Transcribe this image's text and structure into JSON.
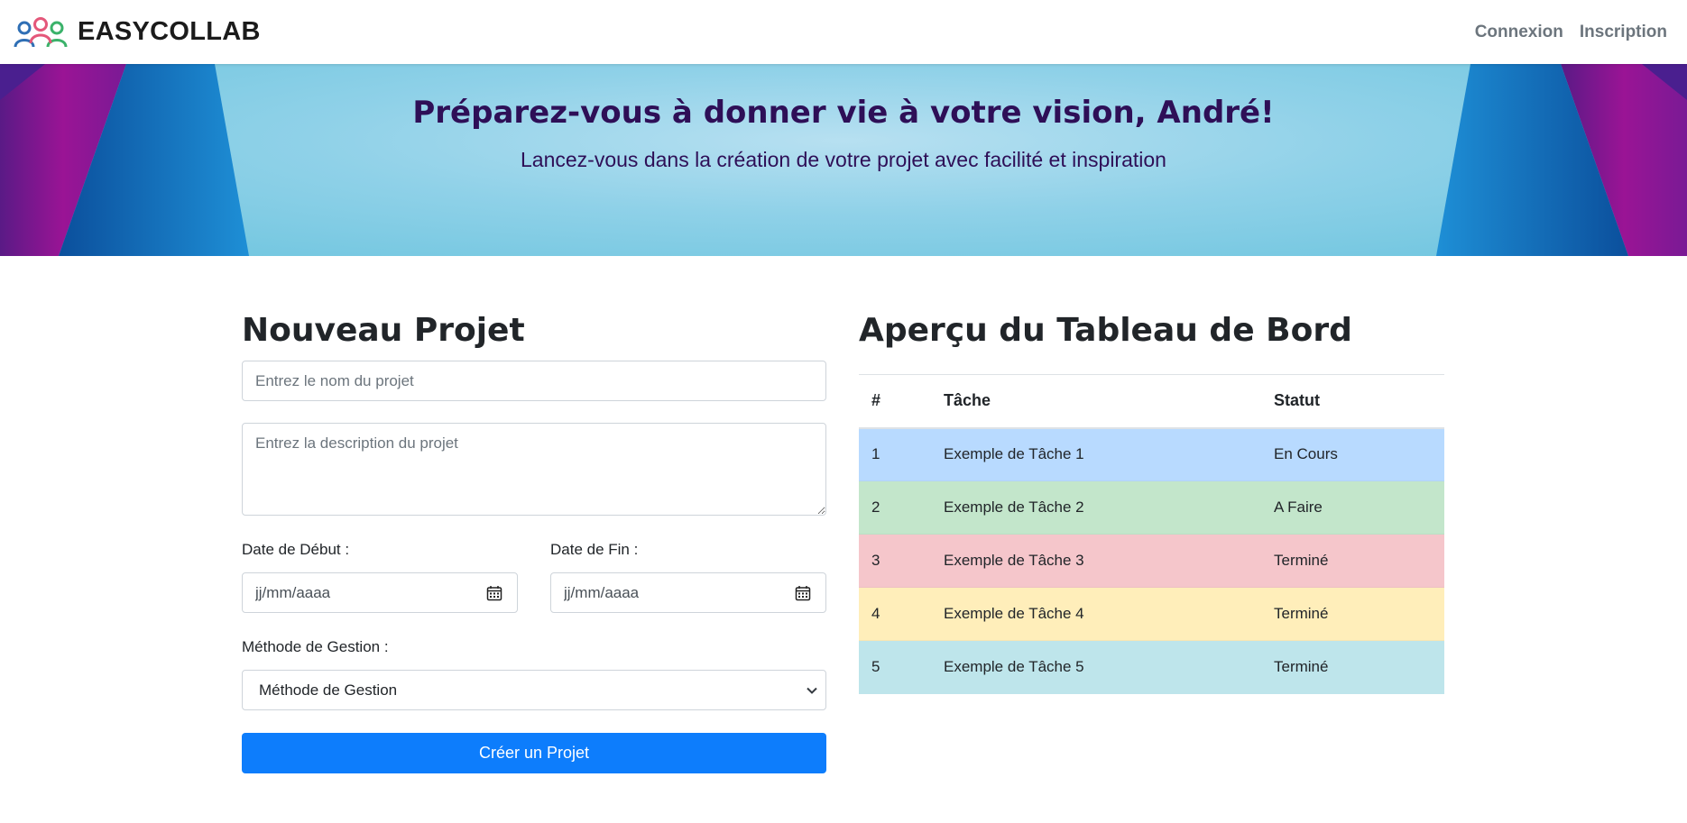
{
  "nav": {
    "brand": "EASYCOLLAB",
    "links": [
      "Connexion",
      "Inscription"
    ]
  },
  "hero": {
    "title": "Préparez-vous à donner vie à votre vision, André!",
    "subtitle": "Lancez-vous dans la création de votre projet avec facilité et inspiration"
  },
  "form": {
    "title": "Nouveau Projet",
    "name_placeholder": "Entrez le nom du projet",
    "description_placeholder": "Entrez la description du projet",
    "start_label": "Date de Début :",
    "end_label": "Date de Fin :",
    "date_placeholder": "jj/mm/aaaa",
    "method_label": "Méthode de Gestion :",
    "method_selected": "Méthode de Gestion",
    "submit_label": "Créer un Projet"
  },
  "dashboard": {
    "title": "Aperçu du Tableau de Bord",
    "headers": [
      "#",
      "Tâche",
      "Statut"
    ],
    "rows": [
      {
        "num": "1",
        "task": "Exemple de Tâche 1",
        "status": "En Cours",
        "color": "#b8daff"
      },
      {
        "num": "2",
        "task": "Exemple de Tâche 2",
        "status": "A Faire",
        "color": "#c3e6cb"
      },
      {
        "num": "3",
        "task": "Exemple de Tâche 3",
        "status": "Terminé",
        "color": "#f5c6cb"
      },
      {
        "num": "4",
        "task": "Exemple de Tâche 4",
        "status": "Terminé",
        "color": "#ffeeba"
      },
      {
        "num": "5",
        "task": "Exemple de Tâche 5",
        "status": "Terminé",
        "color": "#bee5eb"
      }
    ]
  },
  "colors": {
    "primary": "#0d7dfc",
    "hero_text": "#2e0f57",
    "nav_link": "#6c757d"
  },
  "icons": {
    "logo": "people-group-icon",
    "calendar": "calendar-icon",
    "select_arrow": "chevron-down-icon"
  }
}
